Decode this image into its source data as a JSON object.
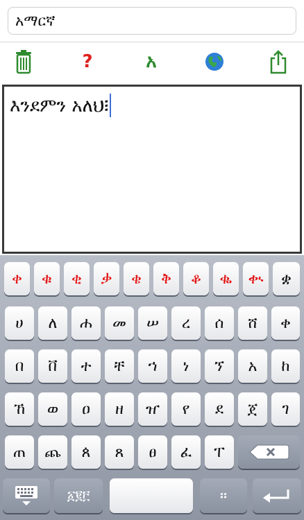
{
  "language_field": {
    "value": "አማርኛ"
  },
  "toolbar": {
    "trash_icon": "trash-icon",
    "help_label": "?",
    "letter_label": "አ",
    "globe_icon": "globe-icon",
    "share_icon": "share-icon"
  },
  "editor": {
    "text": "እንደምን አለህ፧"
  },
  "keyboard": {
    "row0": [
      "ቀ",
      "ቁ",
      "ቂ",
      "ቃ",
      "ቄ",
      "ቅ",
      "ቆ",
      "ቈ",
      "ቊ",
      "ቋ"
    ],
    "row1": [
      "ሀ",
      "ለ",
      "ሐ",
      "መ",
      "ሠ",
      "ረ",
      "ሰ",
      "ሸ",
      "ቀ"
    ],
    "row2": [
      "በ",
      "ቨ",
      "ተ",
      "ቸ",
      "ኀ",
      "ነ",
      "ኘ",
      "አ",
      "ከ"
    ],
    "row3": [
      "ኸ",
      "ወ",
      "ዐ",
      "ዘ",
      "ዠ",
      "የ",
      "ደ",
      "ጀ",
      "ገ"
    ],
    "row4": [
      "ጠ",
      "ጨ",
      "ጰ",
      "ጸ",
      "ፀ",
      "ፈ",
      "ፐ"
    ],
    "numbers_label": "፩፪፫",
    "punct_label": "።",
    "colors": {
      "accent_red": "#e31212",
      "key_dark": "#8a92a0"
    }
  }
}
